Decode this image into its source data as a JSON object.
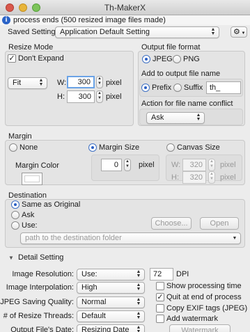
{
  "window": {
    "title": "Th-MakerX"
  },
  "status": {
    "message": "process ends (500 resized image files made)"
  },
  "saved_settings": {
    "label": "Saved Settings:",
    "value": "Application Default Setting"
  },
  "resize_mode": {
    "title": "Resize Mode",
    "dont_expand": "Don't Expand",
    "mode": "Fit",
    "w_label": "W:",
    "w_value": "300",
    "w_unit": "pixel",
    "h_label": "H:",
    "h_value": "300",
    "h_unit": "pixel"
  },
  "output_format": {
    "title": "Output file format",
    "jpeg": "JPEG",
    "png": "PNG"
  },
  "add_name": {
    "title": "Add to output file name",
    "prefix": "Prefix",
    "suffix": "Suffix",
    "value": "th_"
  },
  "conflict": {
    "title": "Action for file name conflict",
    "value": "Ask"
  },
  "margin": {
    "title": "Margin",
    "none": "None",
    "margin_size": "Margin Size",
    "canvas_size": "Canvas Size",
    "color_label": "Margin Color",
    "size_value": "0",
    "size_unit": "pixel",
    "canvas_w_label": "W:",
    "canvas_w": "320",
    "canvas_w_unit": "pixel",
    "canvas_h_label": "H:",
    "canvas_h": "320",
    "canvas_h_unit": "pixel"
  },
  "destination": {
    "title": "Destination",
    "same": "Same as Original",
    "ask": "Ask",
    "use": "Use:",
    "choose": "Choose...",
    "open": "Open",
    "path_placeholder": "path to the destination folder"
  },
  "detail": {
    "title": "Detail Setting",
    "resolution_label": "Image Resolution:",
    "resolution_value": "Use:",
    "dpi_value": "72",
    "dpi_unit": "DPI",
    "interp_label": "Image Interpolation:",
    "interp_value": "High",
    "jpeg_label": "JPEG Saving Quality:",
    "jpeg_value": "Normal",
    "threads_label": "# of Resize Threads:",
    "threads_value": "Default",
    "date_label": "Output File's Date:",
    "date_value": "Resizing Date",
    "show_time": "Show processing time",
    "quit_end": "Quit at end of process",
    "copy_exif": "Copy EXIF tags (JPEG)",
    "add_watermark": "Add watermark",
    "watermark_setup": "Watermark Setup..."
  }
}
